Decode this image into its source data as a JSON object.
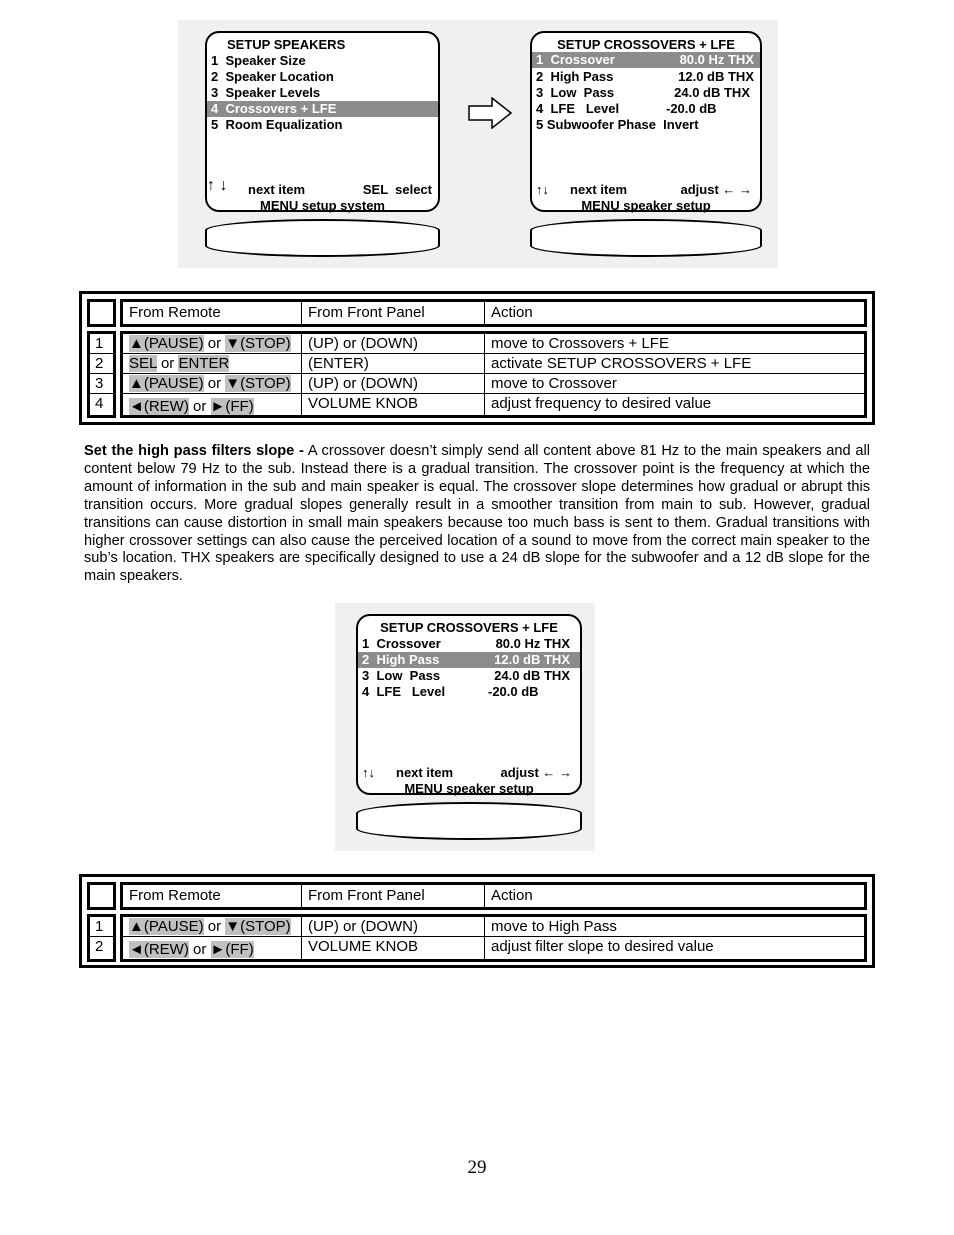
{
  "figure1": {
    "left_screen": {
      "title": "SETUP SPEAKERS",
      "items": [
        {
          "num": "1",
          "label": "Speaker Size",
          "highlighted": false
        },
        {
          "num": "2",
          "label": "Speaker Location",
          "highlighted": false
        },
        {
          "num": "3",
          "label": "Speaker Levels",
          "highlighted": false
        },
        {
          "num": "4",
          "label": "Crossovers + LFE",
          "highlighted": true
        },
        {
          "num": "5",
          "label": "Room Equalization",
          "highlighted": false
        }
      ],
      "nav_arrows": "↑ ↓",
      "nav_label": "next item",
      "action_label": "SEL  select",
      "menu_label": "MENU setup system"
    },
    "right_screen": {
      "title": "SETUP CROSSOVERS + LFE",
      "items": [
        {
          "num": "1",
          "label": "Crossover",
          "value": "80.0 Hz THX",
          "highlighted": true
        },
        {
          "num": "2",
          "label": "High Pass",
          "value": "12.0 dB THX",
          "highlighted": false
        },
        {
          "num": "3",
          "label": "Low  Pass",
          "value": "24.0 dB THX",
          "highlighted": false
        },
        {
          "num": "4",
          "label": "LFE   Level",
          "value": "-20.0 dB",
          "highlighted": false
        },
        {
          "num": "5",
          "label": "Subwoofer Phase",
          "value": "Invert",
          "highlighted": false
        }
      ],
      "nav_arrows": "↑↓",
      "nav_label": "next item",
      "action_label": "adjust ← →",
      "menu_label": "MENU speaker setup"
    }
  },
  "table1": {
    "headers": [
      "From Remote",
      "From Front Panel",
      "Action"
    ],
    "rows": [
      {
        "num": "1",
        "remote_a": "▲(PAUSE)",
        "remote_or": " or ",
        "remote_b": "▼(STOP)",
        "panel": "(UP) or (DOWN)",
        "action": "move to Crossovers + LFE"
      },
      {
        "num": "2",
        "remote_a": "SEL",
        "remote_or": " or ",
        "remote_b": "ENTER",
        "panel": "(ENTER)",
        "action": "activate SETUP CROSSOVERS + LFE"
      },
      {
        "num": "3",
        "remote_a": "▲(PAUSE)",
        "remote_or": " or ",
        "remote_b": "▼(STOP)",
        "panel": "(UP) or (DOWN)",
        "action": "move to Crossover"
      },
      {
        "num": "4",
        "remote_a": "◄(REW)",
        "remote_or": " or ",
        "remote_b": "►(FF)",
        "panel": "VOLUME KNOB",
        "action": "adjust frequency to desired value"
      }
    ]
  },
  "paragraph": {
    "heading": "Set the high pass filters slope -",
    "body": " A crossover doesn’t simply send all content above 81 Hz to the main speakers and all content below 79 Hz to the sub. Instead there is a gradual transition. The crossover point is the frequency at which the amount of information in the sub and main speaker is equal. The crossover slope determines how gradual or abrupt this transition occurs. More gradual slopes generally result in a smoother transition from main to sub. However, gradual transitions can cause distortion in small main speakers because too much bass is sent to them. Gradual transitions with higher crossover settings can also cause the perceived location of a sound to move from the correct main speaker to the sub’s location. THX speakers are specifically designed to use a 24 dB slope for the subwoofer and a 12 dB slope for the main speakers."
  },
  "figure2": {
    "screen": {
      "title": "SETUP CROSSOVERS + LFE",
      "items": [
        {
          "num": "1",
          "label": "Crossover",
          "value": "80.0 Hz THX",
          "highlighted": false
        },
        {
          "num": "2",
          "label": "High Pass",
          "value": "12.0 dB THX",
          "highlighted": true
        },
        {
          "num": "3",
          "label": "Low  Pass",
          "value": "24.0 dB THX",
          "highlighted": false
        },
        {
          "num": "4",
          "label": "LFE   Level",
          "value": "-20.0 dB",
          "highlighted": false
        }
      ],
      "nav_arrows": "↑↓",
      "nav_label": "next item",
      "action_label": "adjust ← →",
      "menu_label": "MENU speaker setup"
    }
  },
  "table2": {
    "headers": [
      "From Remote",
      "From Front Panel",
      "Action"
    ],
    "rows": [
      {
        "num": "1",
        "remote_a": "▲(PAUSE)",
        "remote_or": " or ",
        "remote_b": "▼(STOP)",
        "panel": "(UP) or (DOWN)",
        "action": "move to High Pass"
      },
      {
        "num": "2",
        "remote_a": "◄(REW)",
        "remote_or": " or ",
        "remote_b": "►(FF)",
        "panel": "VOLUME KNOB",
        "action": "adjust filter slope to desired value"
      }
    ]
  },
  "page_number": "29"
}
